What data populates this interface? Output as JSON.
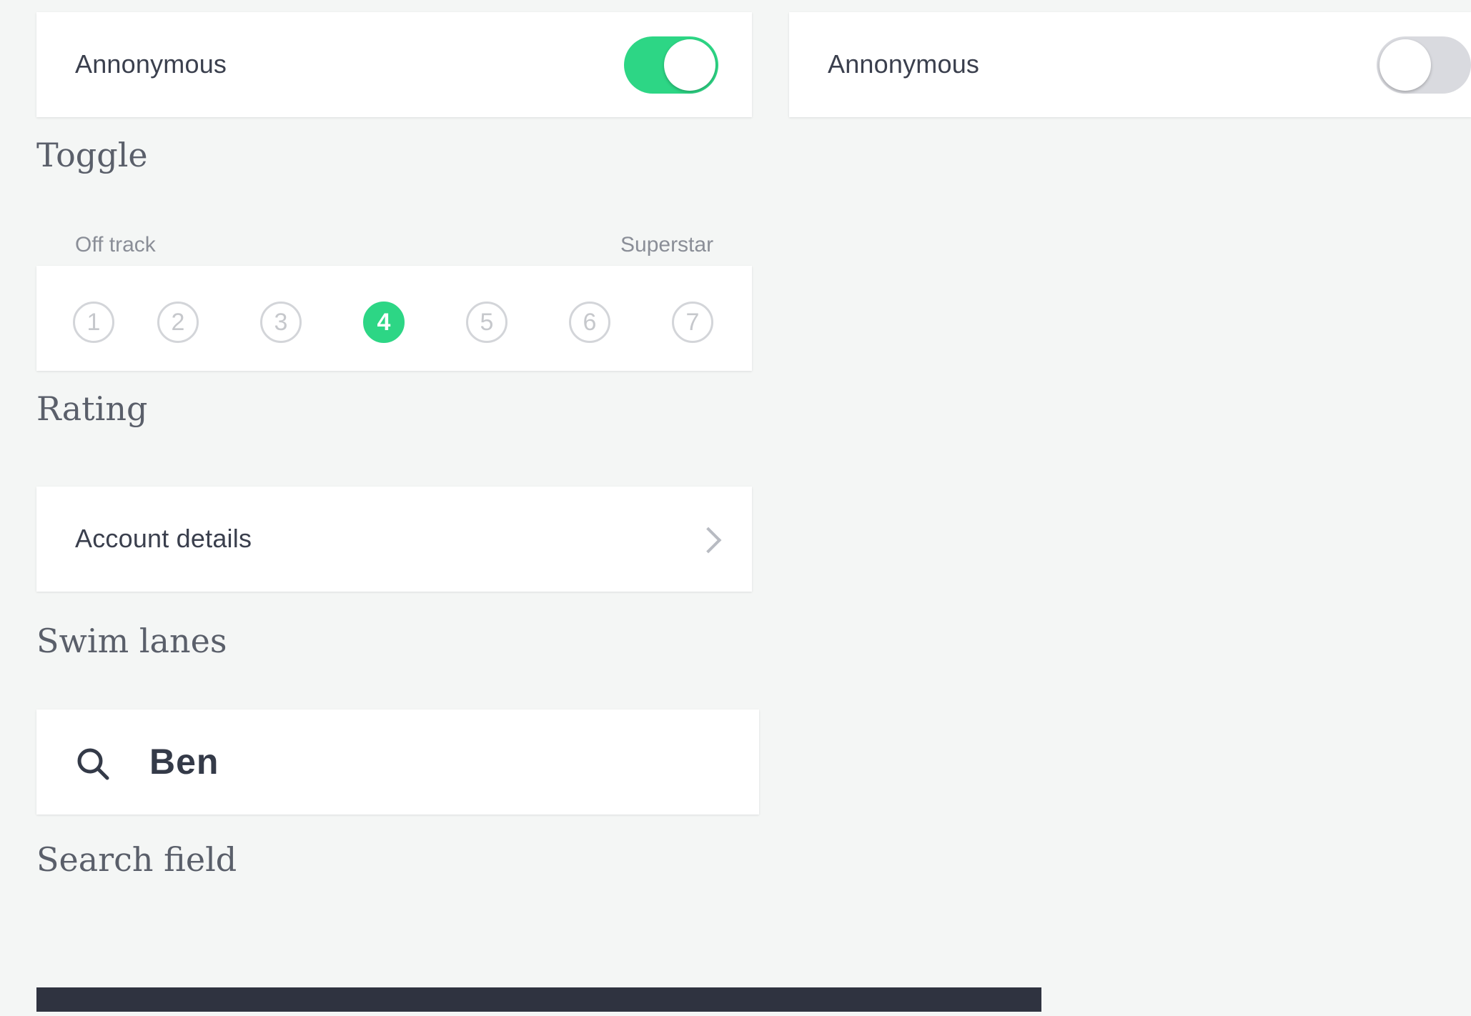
{
  "toggle_section": {
    "left_card": {
      "label": "Annonymous",
      "state": "on"
    },
    "right_card": {
      "label": "Annonymous",
      "state": "off"
    },
    "caption": "Toggle"
  },
  "rating_section": {
    "low_label": "Off track",
    "high_label": "Superstar",
    "options": [
      "1",
      "2",
      "3",
      "4",
      "5",
      "6",
      "7"
    ],
    "selected": "4",
    "caption": "Rating"
  },
  "swim_lanes_section": {
    "row_label": "Account details",
    "caption": "Swim lanes"
  },
  "search_section": {
    "value": "Ben",
    "caption": "Search field"
  },
  "colors": {
    "accent": "#2dd685",
    "toggle_off": "#d9dadf",
    "text_dark": "#3a3f4d",
    "background": "#f4f6f5",
    "bottom_bar": "#2f3340"
  }
}
